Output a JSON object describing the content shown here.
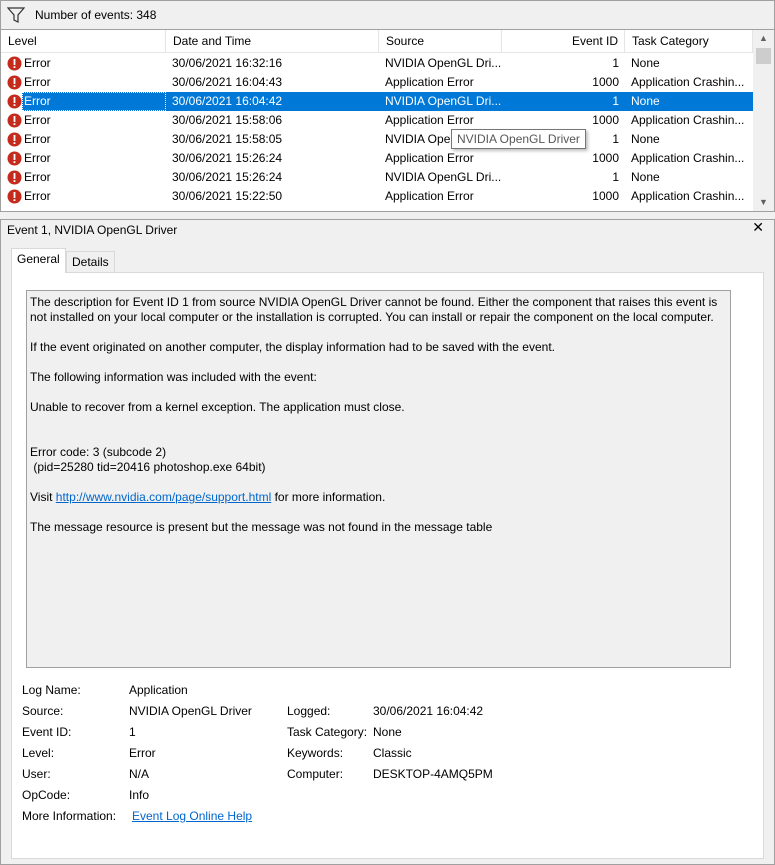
{
  "filter": {
    "count_text": "Number of events: 348"
  },
  "columns": {
    "level": "Level",
    "datetime": "Date and Time",
    "source": "Source",
    "event_id": "Event ID",
    "task_category": "Task Category"
  },
  "rows": [
    {
      "level": "Error",
      "datetime": "30/06/2021 16:32:16",
      "source": "NVIDIA OpenGL Dri...",
      "event_id": "1",
      "task_category": "None"
    },
    {
      "level": "Error",
      "datetime": "30/06/2021 16:04:43",
      "source": "Application Error",
      "event_id": "1000",
      "task_category": "Application Crashin..."
    },
    {
      "level": "Error",
      "datetime": "30/06/2021 16:04:42",
      "source": "NVIDIA OpenGL Dri...",
      "event_id": "1",
      "task_category": "None"
    },
    {
      "level": "Error",
      "datetime": "30/06/2021 15:58:06",
      "source": "Application Error",
      "event_id": "1000",
      "task_category": "Application Crashin..."
    },
    {
      "level": "Error",
      "datetime": "30/06/2021 15:58:05",
      "source": "NVIDIA Oper",
      "event_id": "1",
      "task_category": "None"
    },
    {
      "level": "Error",
      "datetime": "30/06/2021 15:26:24",
      "source": "Application Error",
      "event_id": "1000",
      "task_category": "Application Crashin..."
    },
    {
      "level": "Error",
      "datetime": "30/06/2021 15:26:24",
      "source": "NVIDIA OpenGL Dri...",
      "event_id": "1",
      "task_category": "None"
    },
    {
      "level": "Error",
      "datetime": "30/06/2021 15:22:50",
      "source": "Application Error",
      "event_id": "1000",
      "task_category": "Application Crashin..."
    }
  ],
  "tooltip": "NVIDIA OpenGL Driver",
  "details": {
    "title": "Event 1, NVIDIA OpenGL Driver",
    "close": "✕",
    "tabs": {
      "general": "General",
      "details": "Details"
    },
    "description": {
      "p1": "The description for Event ID 1 from source NVIDIA OpenGL Driver cannot be found. Either the component that raises this event is not installed on your local computer or the installation is corrupted. You can install or repair the component on the local computer.",
      "p2": "If the event originated on another computer, the display information had to be saved with the event.",
      "p3": "The following information was included with the event:",
      "p4": "Unable to recover from a kernel exception. The application must close.",
      "p5a": "Error code: 3 (subcode 2)",
      "p5b": " (pid=25280 tid=20416 photoshop.exe 64bit)",
      "visit_prefix": "Visit ",
      "visit_link": "http://www.nvidia.com/page/support.html",
      "visit_suffix": " for more information.",
      "p7": "The message resource is present but the message was not found in the message table"
    },
    "labels": {
      "log_name": "Log Name:",
      "source": "Source:",
      "event_id": "Event ID:",
      "level": "Level:",
      "user": "User:",
      "opcode": "OpCode:",
      "more_info": "More Information:",
      "logged": "Logged:",
      "task_category": "Task Category:",
      "keywords": "Keywords:",
      "computer": "Computer:"
    },
    "values": {
      "log_name": "Application",
      "source": "NVIDIA OpenGL Driver",
      "event_id": "1",
      "level": "Error",
      "user": "N/A",
      "opcode": "Info",
      "more_info_link": "Event Log Online Help",
      "logged": "30/06/2021 16:04:42",
      "task_category": "None",
      "keywords": "Classic",
      "computer": "DESKTOP-4AMQ5PM"
    }
  },
  "colors": {
    "selection": "#0078d7",
    "error_icon": "#c42b1c",
    "link": "#0066cc"
  }
}
